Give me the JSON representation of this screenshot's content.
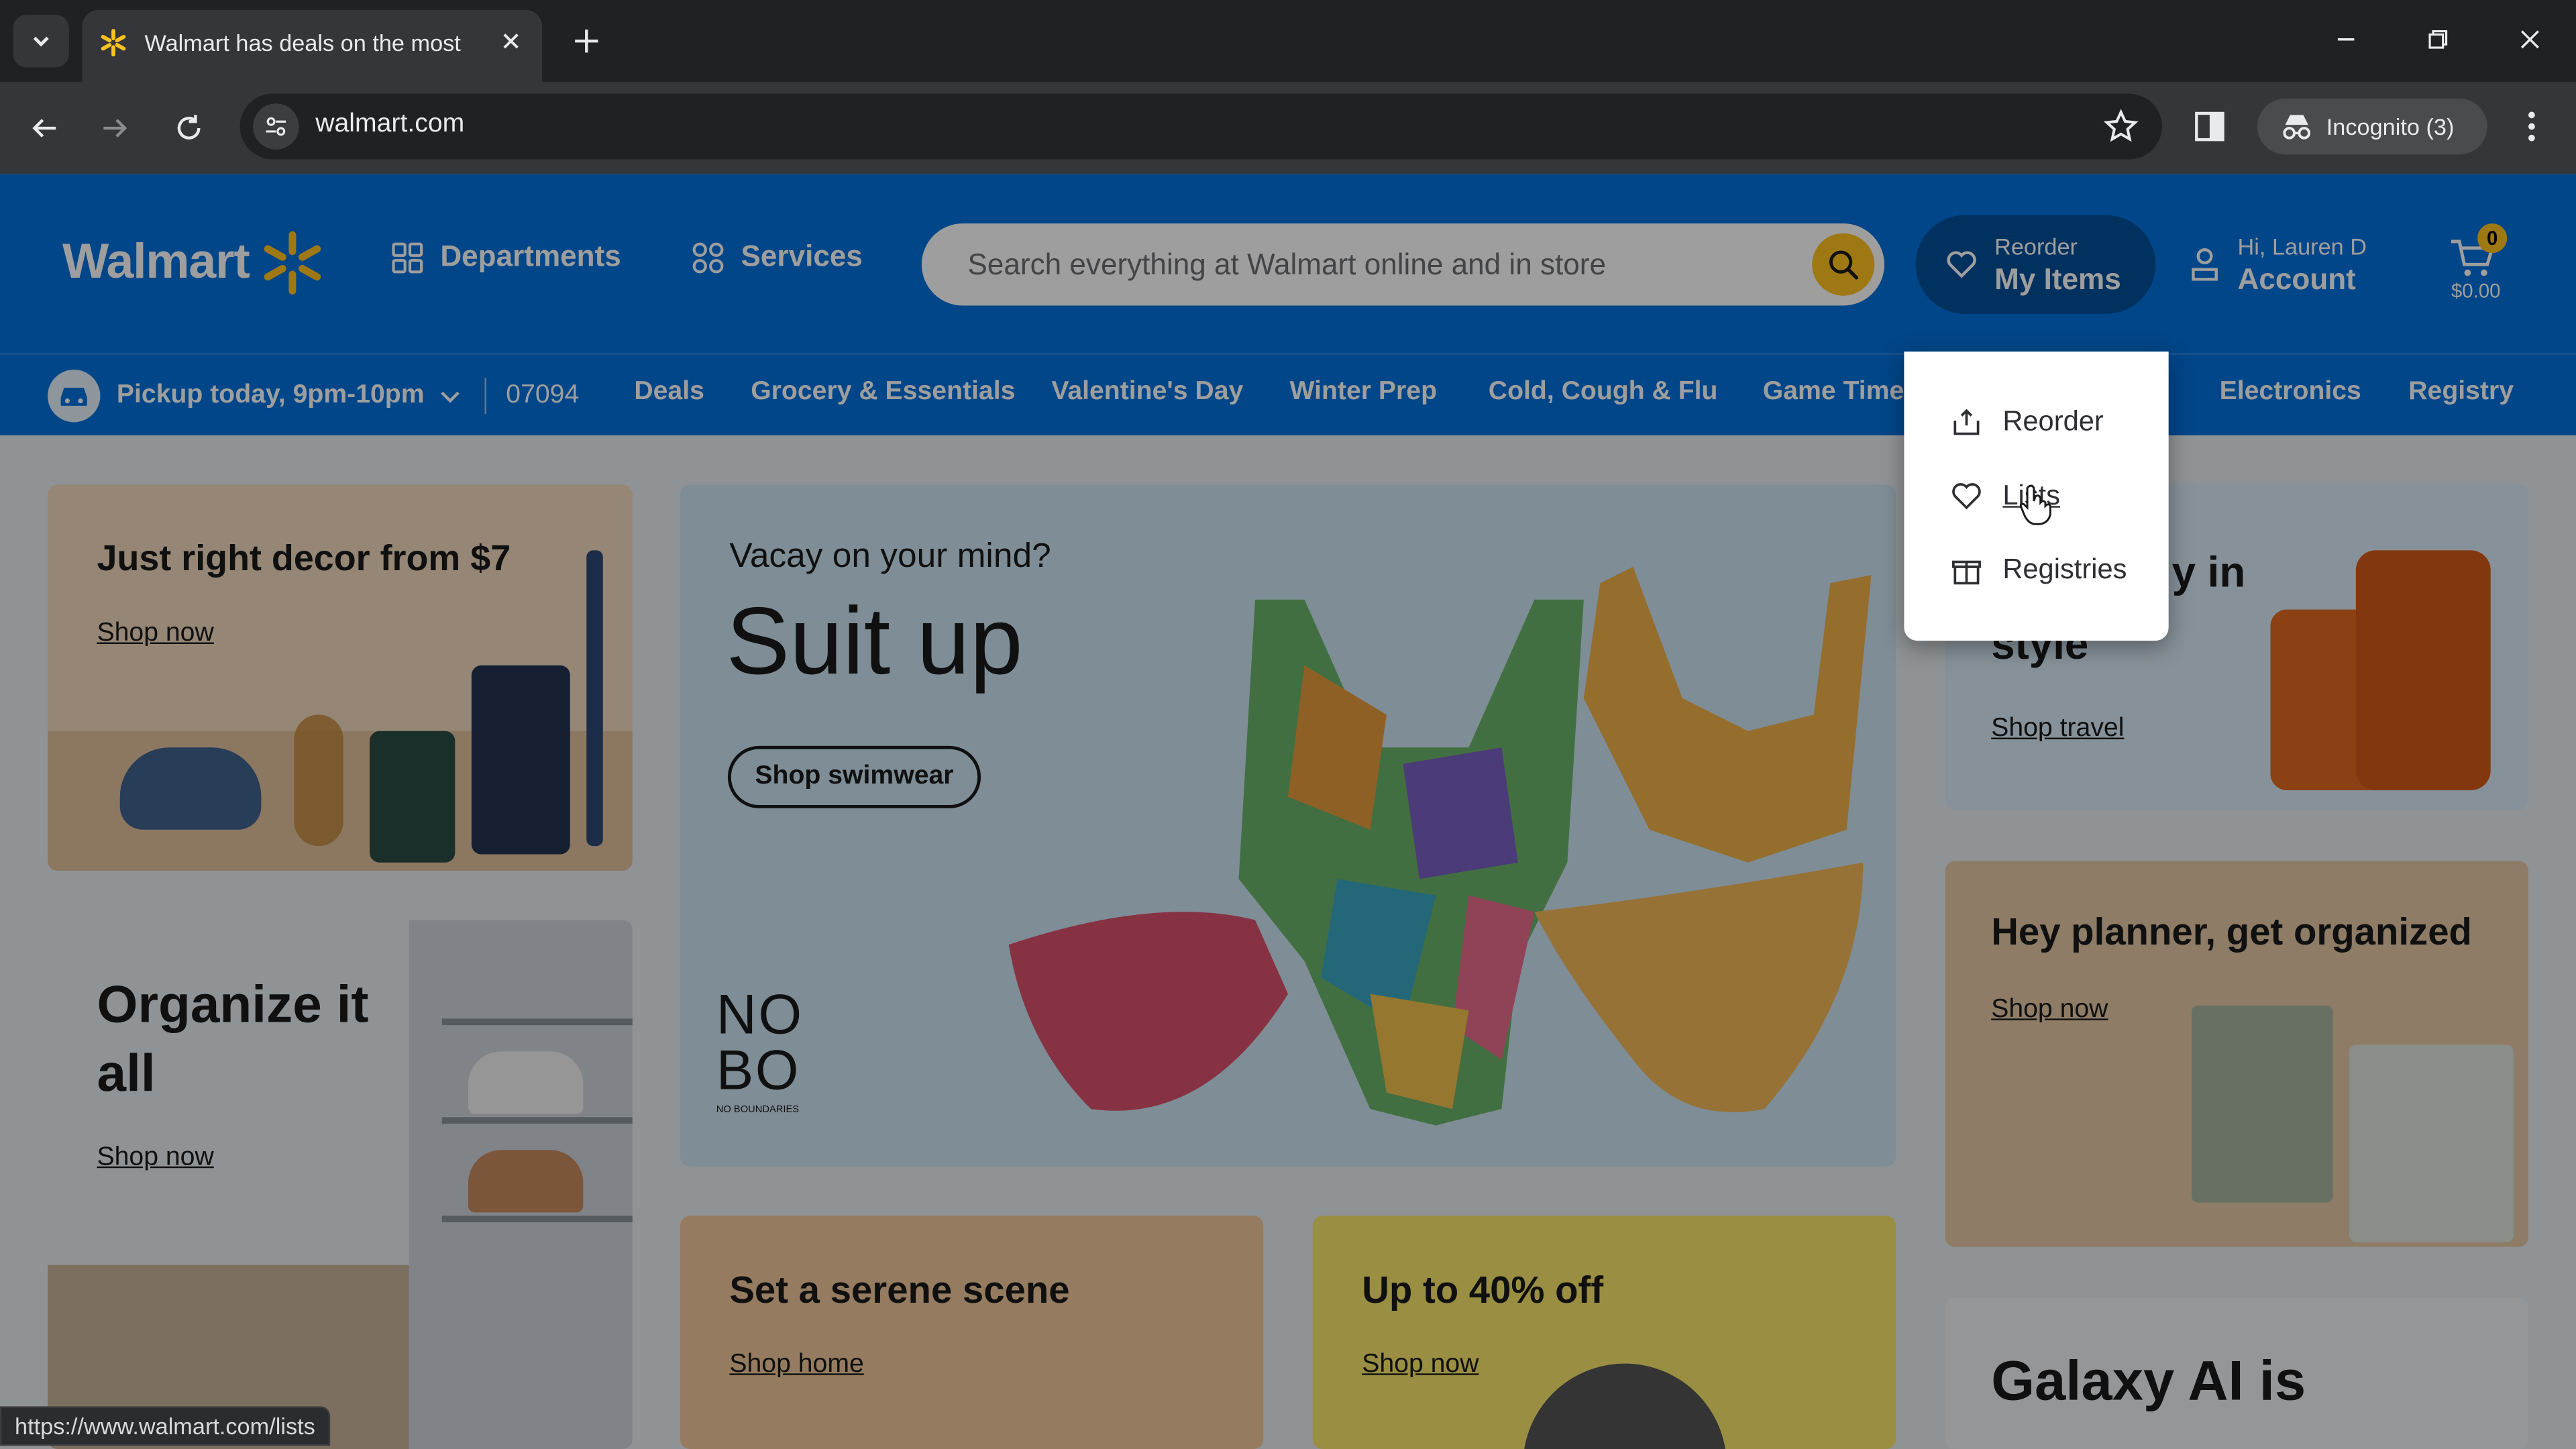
{
  "browser": {
    "tab_title": "Walmart has deals on the most",
    "url": "walmart.com",
    "incognito_label": "Incognito (3)",
    "status_url": "https://www.walmart.com/lists"
  },
  "header": {
    "logo_text": "Walmart",
    "departments": "Departments",
    "services": "Services",
    "search_placeholder": "Search everything at Walmart online and in store",
    "reorder_small": "Reorder",
    "reorder_big": "My Items",
    "account_small": "Hi, Lauren D",
    "account_big": "Account",
    "cart_count": "0",
    "cart_total": "$0.00"
  },
  "subnav": {
    "pickup": "Pickup today, 9pm-10pm",
    "zip": "07094",
    "links": [
      "Deals",
      "Grocery & Essentials",
      "Valentine's Day",
      "Winter Prep",
      "Cold, Cough & Flu",
      "Game Time",
      "Electronics",
      "Registry"
    ]
  },
  "dropdown": {
    "items": [
      "Reorder",
      "Lists",
      "Registries"
    ]
  },
  "cards": {
    "decor": {
      "title": "Just right decor from $7",
      "link": "Shop now"
    },
    "hero": {
      "kicker": "Vacay on your mind?",
      "title": "Suit up",
      "button": "Shop swimwear",
      "brand_line1": "NO",
      "brand_line2": "BO",
      "brand_sub": "NO BOUNDARIES"
    },
    "travel": {
      "title_partial": "y in",
      "title_line2": "style",
      "link": "Shop travel"
    },
    "organize": {
      "title_line1": "Organize it",
      "title_line2": "all",
      "link": "Shop now"
    },
    "planner": {
      "title": "Hey planner, get organized",
      "link": "Shop now"
    },
    "serene": {
      "title": "Set a serene scene",
      "link": "Shop home"
    },
    "sale": {
      "title": "Up to 40% off",
      "link": "Shop now"
    },
    "galaxy": {
      "title": "Galaxy AI is"
    }
  },
  "colors": {
    "walmart_blue": "#0071dc",
    "spark_yellow": "#ffc220"
  }
}
